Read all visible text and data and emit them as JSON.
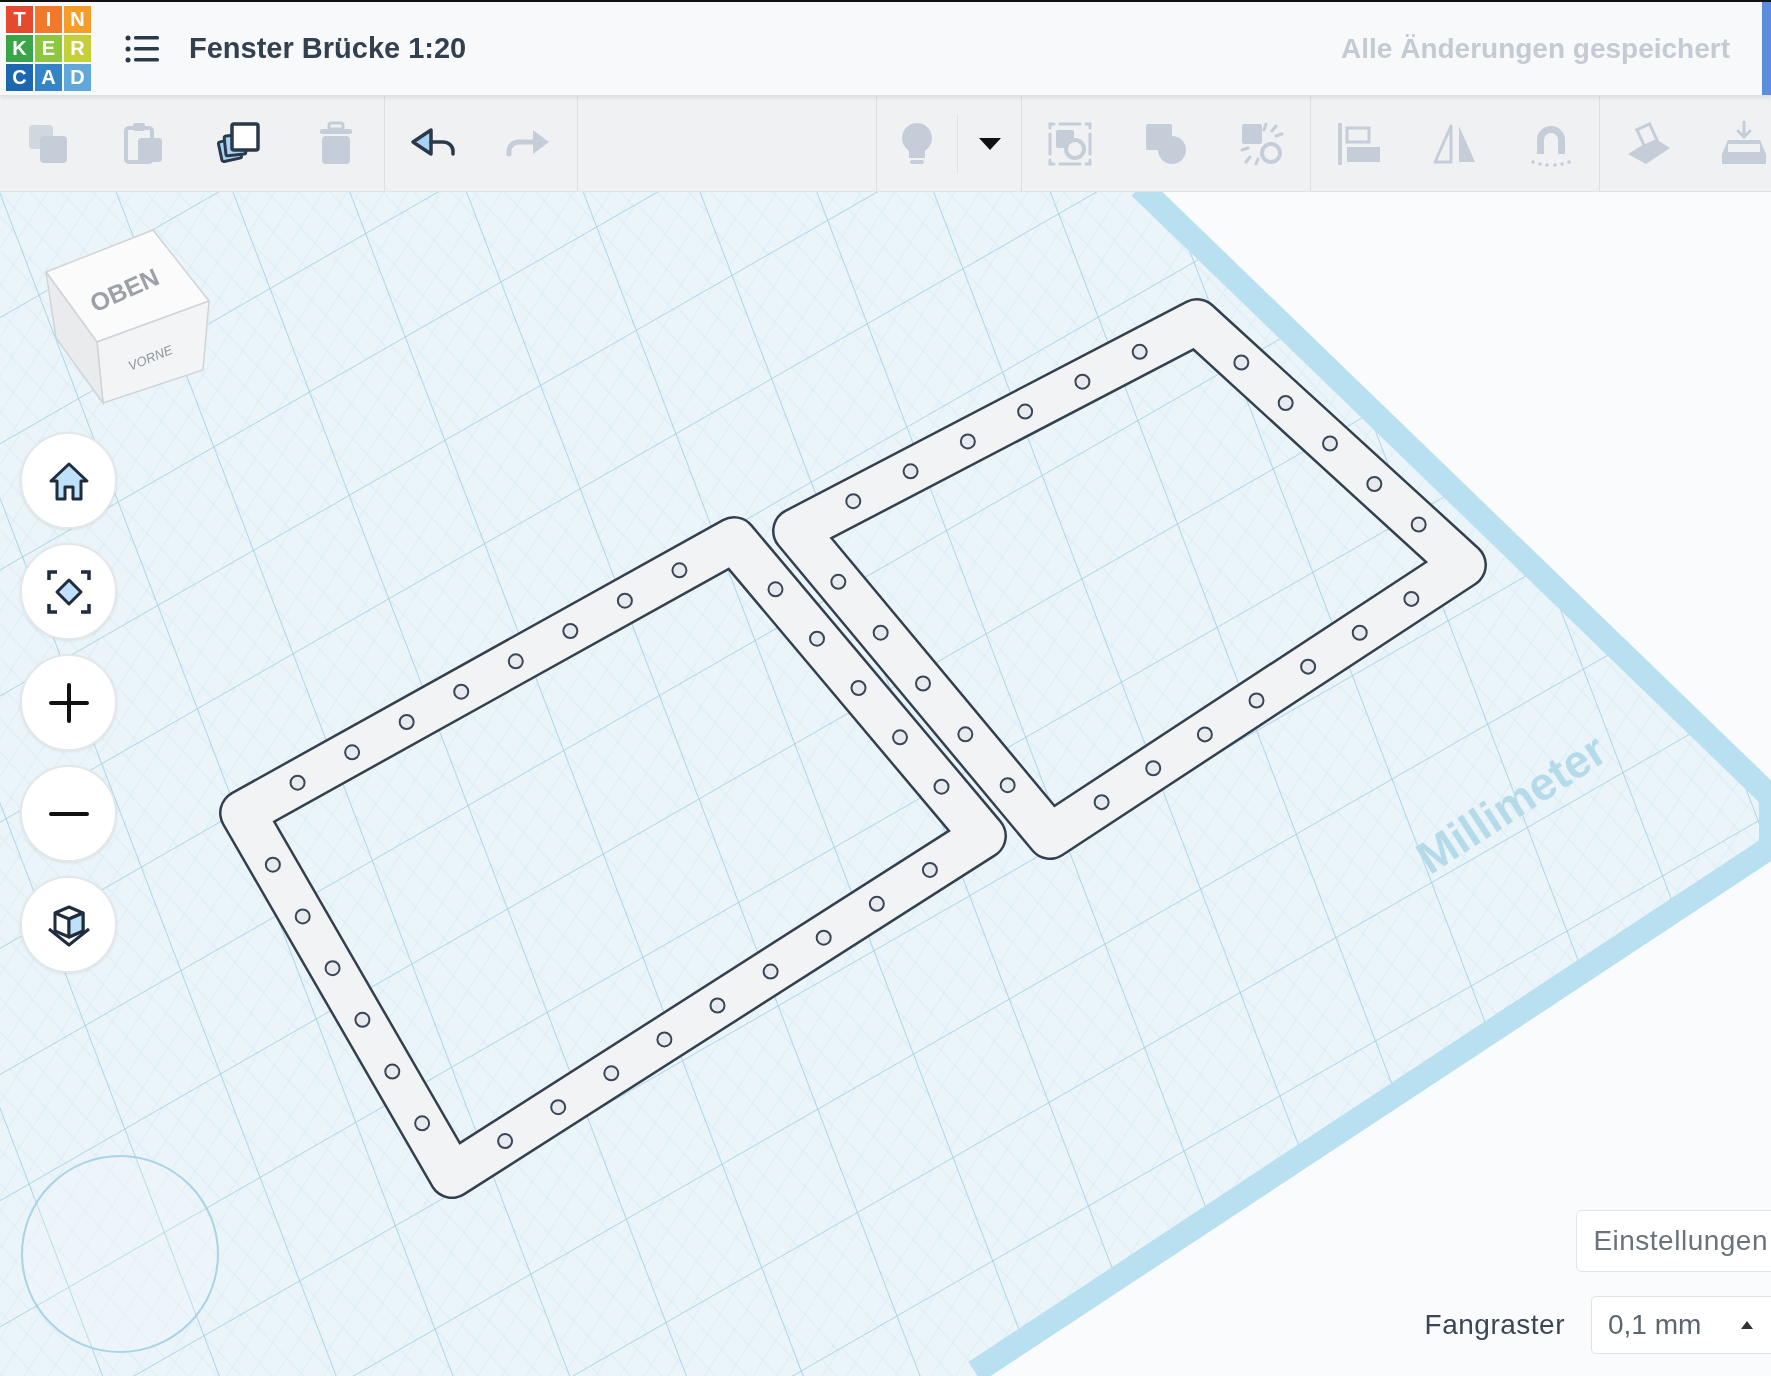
{
  "header": {
    "logo_rows": [
      [
        "T",
        "I",
        "N"
      ],
      [
        "K",
        "E",
        "R"
      ],
      [
        "C",
        "A",
        "D"
      ]
    ],
    "title": "Fenster Brücke 1:20",
    "save_status": "Alle Änderungen gespeichert"
  },
  "toolbar": {
    "groups": [
      {
        "tools": [
          {
            "kind": "copy",
            "disabled": true
          },
          {
            "kind": "paste",
            "disabled": true
          },
          {
            "kind": "duplicate",
            "disabled": false
          },
          {
            "kind": "delete",
            "disabled": true
          }
        ]
      },
      {
        "tools": [
          {
            "kind": "undo",
            "disabled": false
          },
          {
            "kind": "redo",
            "disabled": true
          }
        ]
      },
      {
        "tools": [
          {
            "kind": "light",
            "disabled": true
          },
          {
            "kind": "dropdown",
            "disabled": false
          }
        ]
      },
      {
        "tools": [
          {
            "kind": "group",
            "disabled": true
          },
          {
            "kind": "union",
            "disabled": true
          },
          {
            "kind": "ungroup",
            "disabled": true
          }
        ]
      },
      {
        "tools": [
          {
            "kind": "align",
            "disabled": true
          },
          {
            "kind": "mirror",
            "disabled": true
          },
          {
            "kind": "magnet",
            "disabled": true
          }
        ]
      },
      {
        "tools": [
          {
            "kind": "workplane",
            "disabled": true
          },
          {
            "kind": "drop",
            "disabled": true
          }
        ]
      }
    ]
  },
  "view_cube": {
    "top": "OBEN",
    "front": "VORNE"
  },
  "view_controls": [
    {
      "kind": "home"
    },
    {
      "kind": "fit"
    },
    {
      "kind": "zoom-in"
    },
    {
      "kind": "zoom-out"
    },
    {
      "kind": "perspective"
    }
  ],
  "workplane": {
    "unit_label": "Millimeter"
  },
  "settings_button": "Einstellungen",
  "snap_grid": {
    "label": "Fangraster",
    "value": "0,1 mm"
  }
}
